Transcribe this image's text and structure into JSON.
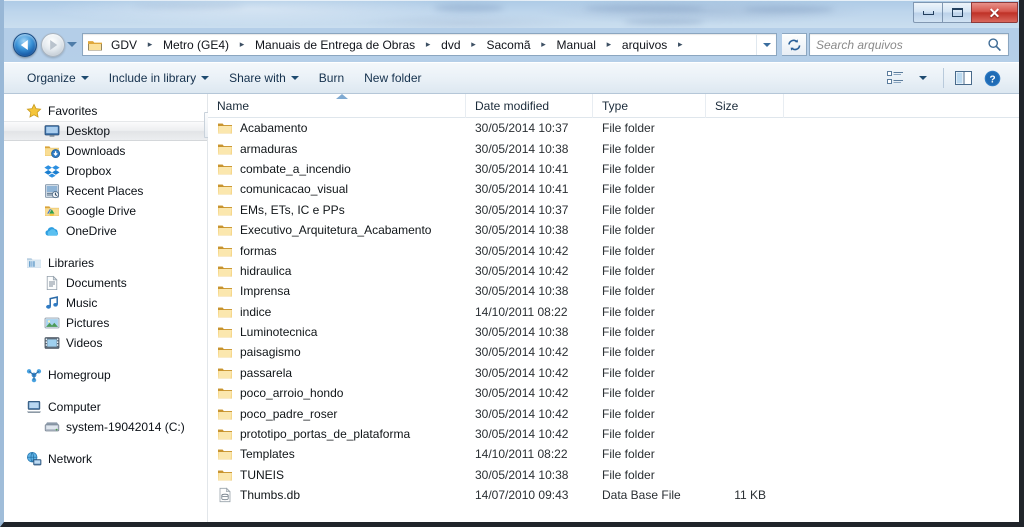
{
  "window": {
    "title_text": "",
    "controls": [
      {
        "name": "minimize",
        "label": "–"
      },
      {
        "name": "maximize",
        "label": "□"
      },
      {
        "name": "close",
        "label": "✕"
      }
    ]
  },
  "navigation": {
    "back_label": "Back",
    "forward_label": "Forward",
    "recent_pages_label": "Recent pages",
    "refresh_label": "↻",
    "breadcrumbs": [
      {
        "label": "GDV"
      },
      {
        "label": "Metro (GE4)"
      },
      {
        "label": "Manuais de Entrega de Obras"
      },
      {
        "label": "dvd"
      },
      {
        "label": "Sacomã"
      },
      {
        "label": "Manual"
      },
      {
        "label": "arquivos"
      }
    ],
    "separator": "▸"
  },
  "search": {
    "placeholder": "Search arquivos",
    "value": "",
    "icon": "search-icon"
  },
  "command_bar": {
    "buttons": [
      {
        "label": "Organize",
        "has_caret": true
      },
      {
        "label": "Include in library",
        "has_caret": true
      },
      {
        "label": "Share with",
        "has_caret": true
      },
      {
        "label": "Burn",
        "has_caret": false
      },
      {
        "label": "New folder",
        "has_caret": false
      }
    ],
    "right_buttons": [
      {
        "name": "change-view-button",
        "icon": "list-view-icon",
        "has_caret": true
      },
      {
        "name": "preview-pane-button",
        "icon": "preview-pane-icon"
      },
      {
        "name": "help-button",
        "icon": "help-icon",
        "label": "?"
      }
    ]
  },
  "nav_pane": {
    "groups": [
      {
        "name": "favorites",
        "header": {
          "label": "Favorites",
          "icon": "star-icon"
        },
        "items": [
          {
            "label": "Desktop",
            "icon": "desktop-icon",
            "selected": true
          },
          {
            "label": "Downloads",
            "icon": "downloads-icon",
            "selected": false
          },
          {
            "label": "Dropbox",
            "icon": "dropbox-icon",
            "selected": false
          },
          {
            "label": "Recent Places",
            "icon": "recent-places-icon",
            "selected": false
          },
          {
            "label": "Google Drive",
            "icon": "google-drive-icon",
            "selected": false
          },
          {
            "label": "OneDrive",
            "icon": "onedrive-icon",
            "selected": false
          }
        ]
      },
      {
        "name": "libraries",
        "header": {
          "label": "Libraries",
          "icon": "libraries-icon"
        },
        "items": [
          {
            "label": "Documents",
            "icon": "documents-icon",
            "selected": false
          },
          {
            "label": "Music",
            "icon": "music-icon",
            "selected": false
          },
          {
            "label": "Pictures",
            "icon": "pictures-icon",
            "selected": false
          },
          {
            "label": "Videos",
            "icon": "videos-icon",
            "selected": false
          }
        ]
      },
      {
        "name": "homegroup",
        "header": {
          "label": "Homegroup",
          "icon": "homegroup-icon"
        },
        "items": []
      },
      {
        "name": "computer",
        "header": {
          "label": "Computer",
          "icon": "computer-icon"
        },
        "items": [
          {
            "label": "system-19042014 (C:)",
            "icon": "hard-drive-icon",
            "selected": false
          }
        ]
      },
      {
        "name": "network",
        "header": {
          "label": "Network",
          "icon": "network-icon"
        },
        "items": []
      }
    ]
  },
  "file_list": {
    "columns": [
      {
        "key": "name",
        "label": "Name",
        "sorted": true
      },
      {
        "key": "date",
        "label": "Date modified",
        "sorted": false
      },
      {
        "key": "type",
        "label": "Type",
        "sorted": false
      },
      {
        "key": "size",
        "label": "Size",
        "sorted": false
      }
    ],
    "rows": [
      {
        "name": "Acabamento",
        "date": "30/05/2014 10:37",
        "type": "File folder",
        "size": "",
        "icon": "folder-icon"
      },
      {
        "name": "armaduras",
        "date": "30/05/2014 10:38",
        "type": "File folder",
        "size": "",
        "icon": "folder-icon"
      },
      {
        "name": "combate_a_incendio",
        "date": "30/05/2014 10:41",
        "type": "File folder",
        "size": "",
        "icon": "folder-icon"
      },
      {
        "name": "comunicacao_visual",
        "date": "30/05/2014 10:41",
        "type": "File folder",
        "size": "",
        "icon": "folder-icon"
      },
      {
        "name": "EMs, ETs, IC e PPs",
        "date": "30/05/2014 10:37",
        "type": "File folder",
        "size": "",
        "icon": "folder-icon"
      },
      {
        "name": "Executivo_Arquitetura_Acabamento",
        "date": "30/05/2014 10:38",
        "type": "File folder",
        "size": "",
        "icon": "folder-icon"
      },
      {
        "name": "formas",
        "date": "30/05/2014 10:42",
        "type": "File folder",
        "size": "",
        "icon": "folder-icon"
      },
      {
        "name": "hidraulica",
        "date": "30/05/2014 10:42",
        "type": "File folder",
        "size": "",
        "icon": "folder-icon"
      },
      {
        "name": "Imprensa",
        "date": "30/05/2014 10:38",
        "type": "File folder",
        "size": "",
        "icon": "folder-icon"
      },
      {
        "name": "indice",
        "date": "14/10/2011 08:22",
        "type": "File folder",
        "size": "",
        "icon": "folder-icon"
      },
      {
        "name": "Luminotecnica",
        "date": "30/05/2014 10:38",
        "type": "File folder",
        "size": "",
        "icon": "folder-icon"
      },
      {
        "name": "paisagismo",
        "date": "30/05/2014 10:42",
        "type": "File folder",
        "size": "",
        "icon": "folder-icon"
      },
      {
        "name": "passarela",
        "date": "30/05/2014 10:42",
        "type": "File folder",
        "size": "",
        "icon": "folder-icon"
      },
      {
        "name": "poco_arroio_hondo",
        "date": "30/05/2014 10:42",
        "type": "File folder",
        "size": "",
        "icon": "folder-icon"
      },
      {
        "name": "poco_padre_roser",
        "date": "30/05/2014 10:42",
        "type": "File folder",
        "size": "",
        "icon": "folder-icon"
      },
      {
        "name": "prototipo_portas_de_plataforma",
        "date": "30/05/2014 10:42",
        "type": "File folder",
        "size": "",
        "icon": "folder-icon"
      },
      {
        "name": "Templates",
        "date": "14/10/2011 08:22",
        "type": "File folder",
        "size": "",
        "icon": "folder-icon"
      },
      {
        "name": "TUNEIS",
        "date": "30/05/2014 10:38",
        "type": "File folder",
        "size": "",
        "icon": "folder-icon"
      },
      {
        "name": "Thumbs.db",
        "date": "14/07/2010 09:43",
        "type": "Data Base File",
        "size": "11 KB",
        "icon": "database-file-icon"
      }
    ]
  },
  "colors": {
    "folder_yellow": "#f5c65a",
    "accent_blue": "#2a6099",
    "close_red": "#c9372c",
    "glass_blue": "#bcd4ea"
  }
}
